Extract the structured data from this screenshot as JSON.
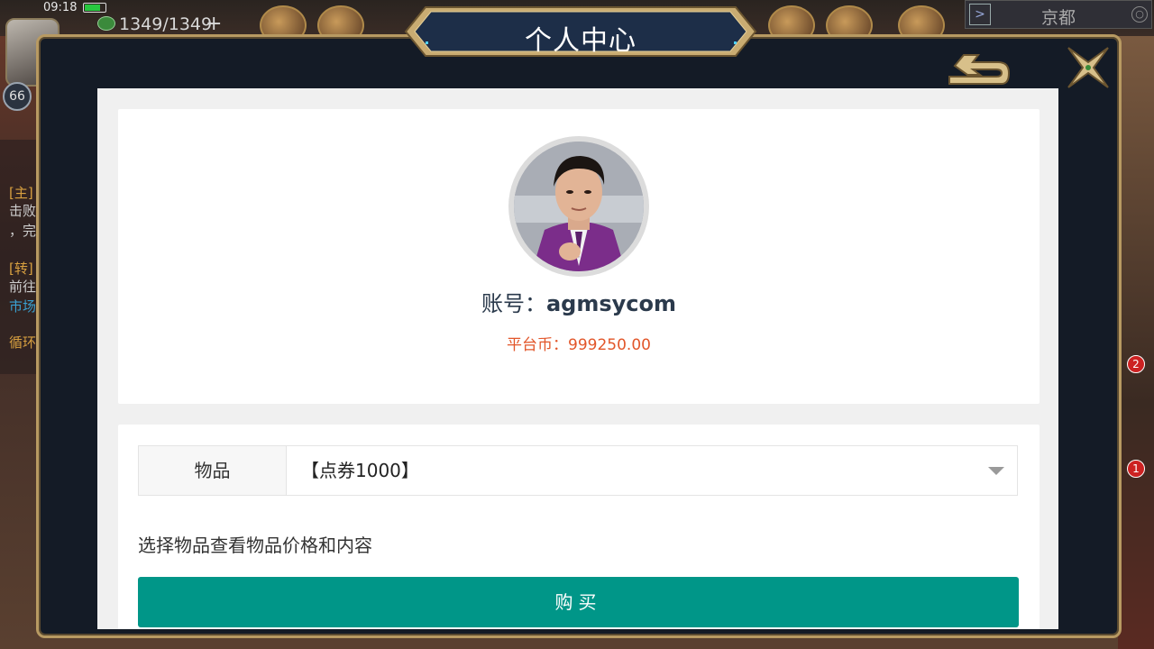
{
  "status_bar": {
    "time": "09:18"
  },
  "hud": {
    "stamina": "1349/1349",
    "stamina_plus": "+",
    "level": "66",
    "region": "京都",
    "left_quests": [
      "[主]",
      "击败",
      "，完",
      "[转]",
      "前往",
      "市场",
      "循环"
    ]
  },
  "modal": {
    "title": "个人中心"
  },
  "profile": {
    "account_label": "账号：",
    "account_value": "agmsycom",
    "coin_label": "平台币：",
    "coin_value": "999250.00"
  },
  "purchase": {
    "item_label": "物品",
    "item_selected": "【点券1000】",
    "hint": "选择物品查看物品价格和内容",
    "buy_label": "购买"
  },
  "colors": {
    "accent_teal": "#009688",
    "coin_orange": "#e2562a",
    "frame_gold": "#b89a62"
  }
}
